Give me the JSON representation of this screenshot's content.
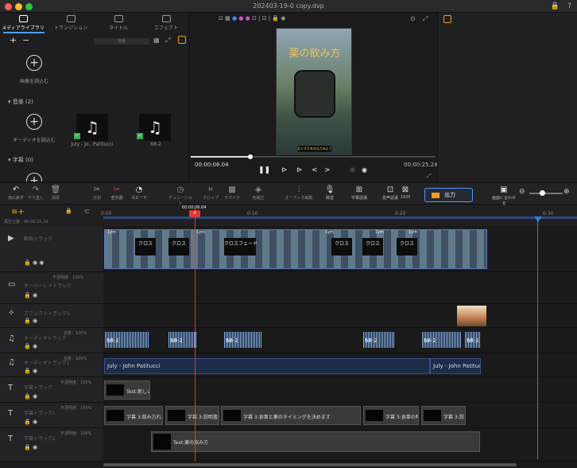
{
  "window": {
    "title": "202403-19-0 copy.dvp"
  },
  "tabs": [
    {
      "label": "メディアライブラリ"
    },
    {
      "label": "トランジション"
    },
    {
      "label": "タイトル"
    },
    {
      "label": "エフェクト"
    }
  ],
  "library": {
    "search_placeholder": "検索",
    "import_image": "画像を読込む",
    "music_header": "音楽",
    "music_count": "(2)",
    "import_audio": "オーディオを読込む",
    "music_items": [
      {
        "label": "July - Jo...Patitucci"
      },
      {
        "label": "68-2"
      }
    ],
    "subtitle_header": "字幕",
    "subtitle_count": "(0)"
  },
  "viewer": {
    "phone_title": "薬の飲み方",
    "phone_button": "おくすりをのんでみよう",
    "current_time": "00:00:06.04",
    "duration": "00:00:25.24"
  },
  "toolbar": {
    "items": [
      {
        "label": "元に戻す"
      },
      {
        "label": "やり直し"
      },
      {
        "label": "削除"
      },
      {
        "label": "分割"
      },
      {
        "label": "全分割"
      },
      {
        "label": "スピード"
      },
      {
        "label": "デュレーション"
      },
      {
        "label": "クロップ"
      },
      {
        "label": "モザイク"
      },
      {
        "label": "色補正"
      },
      {
        "label": "オーディオ編集"
      },
      {
        "label": "録音"
      },
      {
        "label": "字幕認識"
      },
      {
        "label": "音声認識"
      },
      {
        "label": "1920"
      }
    ],
    "export_label": "出力",
    "preview_label": "画面に合わせる"
  },
  "timeline": {
    "playhead": "00:00:06.04",
    "ruler": [
      "0:00",
      "0:10",
      "0:20",
      "0:30"
    ],
    "left_label": "再生位置：00:00:25.24"
  },
  "tracks": [
    {
      "name": "動画トラック",
      "clips": [
        "1ym",
        "1ym",
        "クロス",
        "クロス",
        "1ym",
        "クロスフェード",
        "1ym",
        "1ym",
        "クロス",
        "クロス",
        "クロス"
      ]
    },
    {
      "name": "オーバーレイトラック",
      "volume": "不透明度：100%"
    },
    {
      "name": "エフェクトトラック1"
    },
    {
      "name": "オーディオトラック",
      "volume": "音量：100%",
      "clips": [
        "68-2",
        "68-2",
        "68-2",
        "68-2",
        "68-2",
        "68-2"
      ]
    },
    {
      "name": "オーディオトラック1",
      "volume": "音量：100%",
      "clips": [
        "July - John Patitucci",
        "July - John Patitucci"
      ]
    },
    {
      "name": "字幕トラック",
      "volume": "不透明度：100%",
      "clips": [
        "Text:新しい"
      ]
    },
    {
      "name": "字幕トラック1",
      "volume": "不透明度：100%",
      "clips": [
        "字幕 3:飲み方れ",
        "字幕 3:説明書を",
        "字幕 3:食事と薬のタイミングを決めます",
        "字幕 3:食事の時",
        "字幕 3:説"
      ]
    },
    {
      "name": "字幕トラック2",
      "volume": "不透明度：100%",
      "clips": [
        "Text:薬の飲み方"
      ]
    }
  ]
}
